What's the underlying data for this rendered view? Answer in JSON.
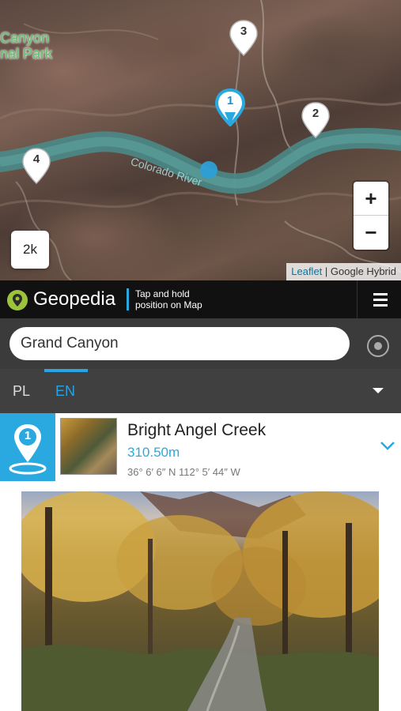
{
  "map": {
    "park_label_line1": "Canyon",
    "park_label_line2": "nal Park",
    "river_label": "Colorado River",
    "markers": [
      "1",
      "2",
      "3",
      "4"
    ],
    "zoom_in": "+",
    "zoom_out": "−",
    "scale_button": "2k",
    "attribution_link": "Leaflet",
    "attribution_text": " | Google Hybrid"
  },
  "header": {
    "app_name": "Geopedia",
    "tagline": "Tap and hold position on Map"
  },
  "search": {
    "value": "Grand Canyon"
  },
  "languages": {
    "items": [
      "PL",
      "EN"
    ],
    "active": "EN"
  },
  "result": {
    "number": "1",
    "title": "Bright Angel Creek",
    "elevation": "310.50m",
    "coordinates": "36° 6′ 6″ N 112° 5′ 44″ W"
  },
  "colors": {
    "accent": "#29a9e0",
    "header_bg": "#111111",
    "search_bg": "#3b3b3b",
    "lang_bg": "#404040",
    "logo_green": "#9bc43a"
  },
  "icons": [
    "map-pin-icon",
    "locate-icon",
    "menu-icon",
    "chevron-down-icon",
    "caret-down-icon",
    "geopedia-logo-icon"
  ]
}
